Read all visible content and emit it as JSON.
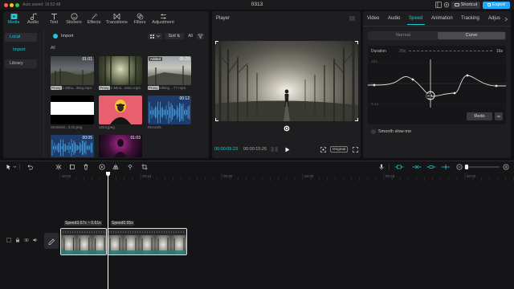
{
  "window": {
    "title": "0313",
    "autosave": "Auto saved: 16:52:48",
    "shortcut_label": "Shortcut",
    "export_label": "Export"
  },
  "media_tabs": [
    {
      "label": "Media",
      "icon": "media-icon"
    },
    {
      "label": "Audio",
      "icon": "audio-icon"
    },
    {
      "label": "Text",
      "icon": "text-icon"
    },
    {
      "label": "Stickers",
      "icon": "stickers-icon"
    },
    {
      "label": "Effects",
      "icon": "effects-icon"
    },
    {
      "label": "Transitions",
      "icon": "transitions-icon"
    },
    {
      "label": "Filters",
      "icon": "filters-icon"
    },
    {
      "label": "Adjustment",
      "icon": "adjustment-icon"
    }
  ],
  "media_sidebar": {
    "local": "Local",
    "import": "Import",
    "library": "Library"
  },
  "media_toolbar": {
    "import_label": "Import",
    "sort_label": "Sort",
    "all_label": "All",
    "filter_all": "All"
  },
  "media_items": [
    {
      "duration": "01:01",
      "caption_tag": "Proxy",
      "caption": "1 Minu...iking.mp4",
      "badge": ""
    },
    {
      "duration": "",
      "caption_tag": "Proxy",
      "caption": "1-Minu...ation.mp4",
      "badge": ""
    },
    {
      "duration": "05:29",
      "caption_tag": "Proxy",
      "caption": "Hiking ...77.mp4",
      "badge": "Added"
    },
    {
      "duration": "",
      "caption_tag": "",
      "caption": "Screenst...4.31.png",
      "badge": ""
    },
    {
      "duration": "",
      "caption_tag": "",
      "caption": "1023.jpeg",
      "badge": ""
    },
    {
      "duration": "00:12",
      "caption_tag": "",
      "caption": "Record1",
      "badge": ""
    },
    {
      "duration": "00:05",
      "caption_tag": "",
      "caption": "",
      "badge": ""
    },
    {
      "duration": "01:03",
      "caption_tag": "",
      "caption": "",
      "badge": ""
    }
  ],
  "player": {
    "title": "Player",
    "current_time": "00:00:05:23",
    "total_time": "00:00:15:26",
    "original_label": "Original"
  },
  "props": {
    "tabs": [
      "Video",
      "Audio",
      "Speed",
      "Animation",
      "Tracking",
      "Adjus"
    ],
    "mode_normal": "Normal",
    "mode_curve": "Curve",
    "duration_label": "Duration",
    "duration_from": "20s",
    "duration_to": "16s",
    "y_top": "10x",
    "y_mid": "1x",
    "y_bottom": "0.1x",
    "redo_label": "Redo",
    "smooth_label": "Smooth slow-mo"
  },
  "timeline": {
    "ruler": [
      "00:00",
      "00:10",
      "00:20",
      "00:30",
      "00:40",
      "00:50"
    ],
    "clip_speed_1": "Speed3.57x ~ 0.61x",
    "clip_speed_2": "Speed0.55x"
  },
  "colors": {
    "accent": "#20c8d8",
    "export": "#1ea8ff"
  }
}
